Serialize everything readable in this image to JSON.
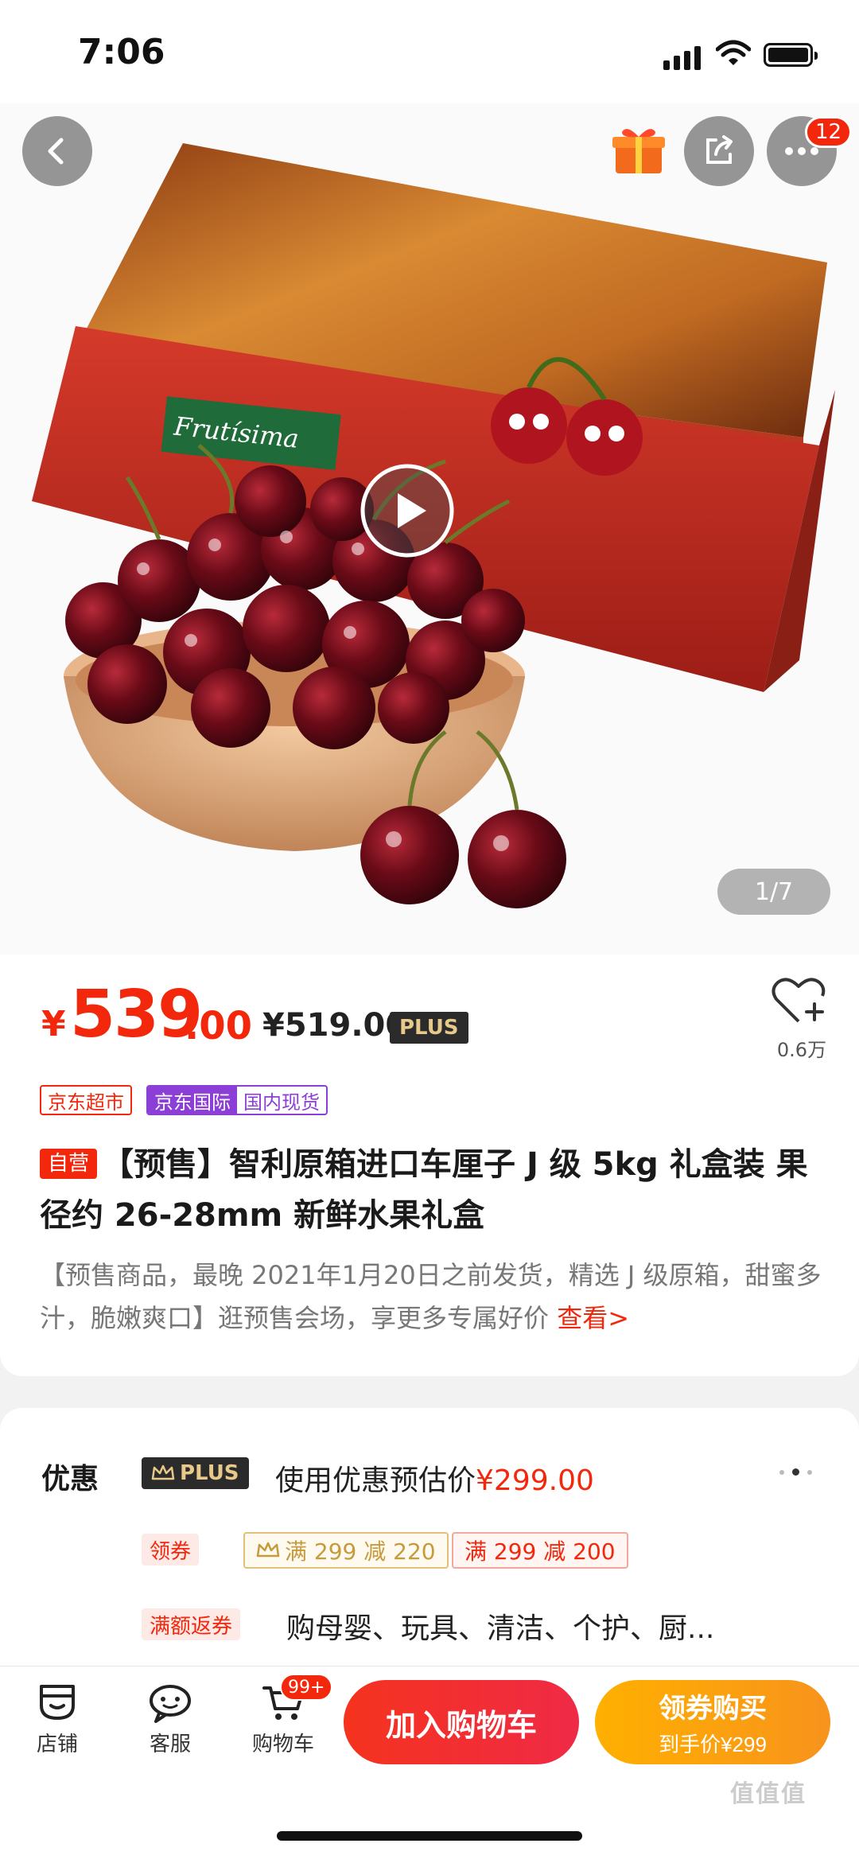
{
  "status_bar": {
    "time": "7:06"
  },
  "header": {
    "more_badge": "12",
    "image_index": "1/7"
  },
  "hero": {
    "box_brand": "Frutísima"
  },
  "price": {
    "currency": "¥",
    "integer": "539",
    "decimal": ".00",
    "plus_price": "¥519.00",
    "plus_label": "PLUS",
    "favorite_count": "0.6万"
  },
  "tags": {
    "jd_supermarket": "京东超市",
    "jd_international": "京东国际",
    "domestic_stock": "国内现货"
  },
  "product": {
    "self_operated": "自营",
    "title": "【预售】智利原箱进口车厘子 J 级 5kg 礼盒装 果径约 26-28mm 新鲜水果礼盒",
    "description": "【预售商品，最晚 2021年1月20日之前发货，精选 J 级原箱，甜蜜多汁，脆嫩爽口】逛预售会场，享更多专属好价 ",
    "description_link": "查看>"
  },
  "promo": {
    "label": "优惠",
    "plus_chip": "PLUS",
    "estimate_text": "使用优惠预估价",
    "estimate_price": "¥299.00",
    "coupon_label": "领券",
    "coupon_plus": "满 299 减 220",
    "coupon_red": "满 299 减 200",
    "return_label": "满额返券",
    "return_text": "购母婴、玩具、清洁、个护、厨..."
  },
  "bottom_bar": {
    "store": "店铺",
    "service": "客服",
    "cart": "购物车",
    "cart_badge": "99+",
    "add_to_cart": "加入购物车",
    "buy_main": "领券购买",
    "buy_sub": "到手价¥299"
  },
  "watermark": "值值值",
  "colors": {
    "accent_red": "#f2270c",
    "buy_orange": "#f8931c",
    "plus_gold": "#e8c98a",
    "intl_purple": "#8b3fd6"
  },
  "icons": [
    "back-icon",
    "gift-icon",
    "share-icon",
    "more-icon",
    "play-icon",
    "heart-add-icon",
    "store-icon",
    "service-icon",
    "cart-icon",
    "crown-icon"
  ]
}
